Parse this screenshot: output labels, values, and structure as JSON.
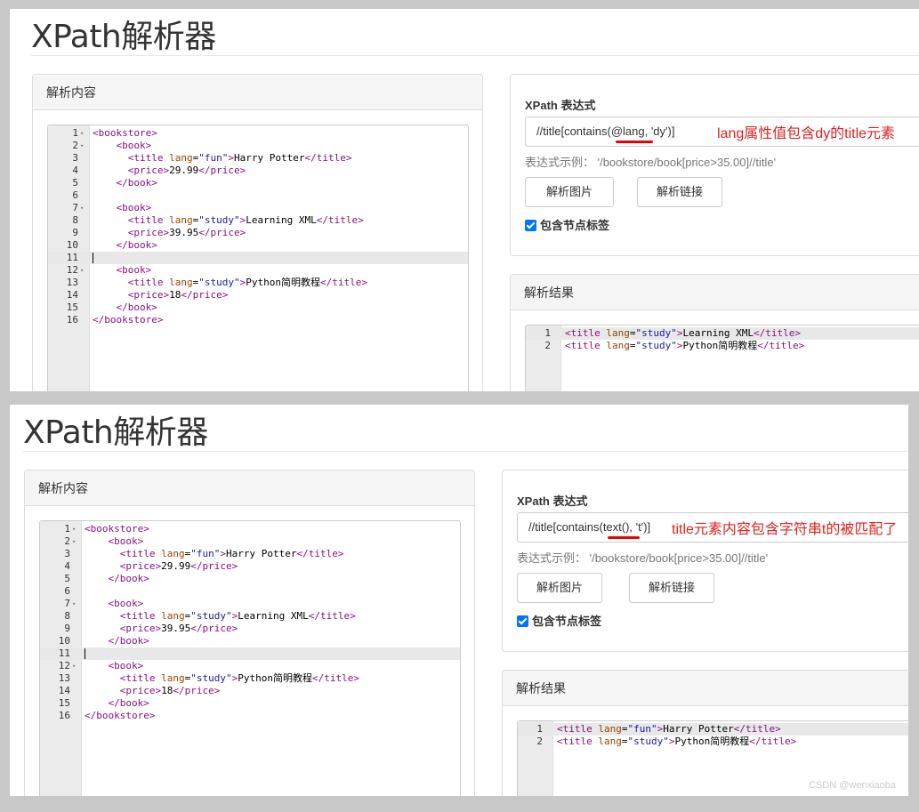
{
  "app": {
    "title": "XPath解析器"
  },
  "panels": {
    "content_heading": "解析内容",
    "xpath_heading": "XPath 表达式",
    "result_heading": "解析结果",
    "example": "表达式示例： '/bookstore/book[price>35.00]//title'",
    "btn_image": "解析图片",
    "btn_link": "解析链接",
    "include_tags": "包含节点标签"
  },
  "source_lines": [
    {
      "n": "1",
      "fold": "▾",
      "html": "<span class='tag'>&lt;bookstore&gt;</span>"
    },
    {
      "n": "2",
      "fold": "▾",
      "html": "    <span class='tag'>&lt;book&gt;</span>"
    },
    {
      "n": "3",
      "fold": "",
      "html": "      <span class='tag'>&lt;title</span> <span class='attr'>lang</span>=<span class='val'>\"fun\"</span><span class='tag'>&gt;</span>Harry Potter<span class='tag'>&lt;/title&gt;</span>"
    },
    {
      "n": "4",
      "fold": "",
      "html": "      <span class='tag'>&lt;price&gt;</span>29.99<span class='tag'>&lt;/price&gt;</span>"
    },
    {
      "n": "5",
      "fold": "",
      "html": "    <span class='tag'>&lt;/book&gt;</span>"
    },
    {
      "n": "6",
      "fold": "",
      "html": ""
    },
    {
      "n": "7",
      "fold": "▾",
      "html": "    <span class='tag'>&lt;book&gt;</span>"
    },
    {
      "n": "8",
      "fold": "",
      "html": "      <span class='tag'>&lt;title</span> <span class='attr'>lang</span>=<span class='val'>\"study\"</span><span class='tag'>&gt;</span>Learning XML<span class='tag'>&lt;/title&gt;</span>"
    },
    {
      "n": "9",
      "fold": "",
      "html": "      <span class='tag'>&lt;price&gt;</span>39.95<span class='tag'>&lt;/price&gt;</span>"
    },
    {
      "n": "10",
      "fold": "",
      "html": "    <span class='tag'>&lt;/book&gt;</span>"
    },
    {
      "n": "11",
      "fold": "",
      "html": "<span class='cursor'></span>",
      "active": true
    },
    {
      "n": "12",
      "fold": "▾",
      "html": "    <span class='tag'>&lt;book&gt;</span>"
    },
    {
      "n": "13",
      "fold": "",
      "html": "      <span class='tag'>&lt;title</span> <span class='attr'>lang</span>=<span class='val'>\"study\"</span><span class='tag'>&gt;</span>Python简明教程<span class='tag'>&lt;/title&gt;</span>"
    },
    {
      "n": "14",
      "fold": "",
      "html": "      <span class='tag'>&lt;price&gt;</span>18<span class='tag'>&lt;/price&gt;</span>"
    },
    {
      "n": "15",
      "fold": "",
      "html": "    <span class='tag'>&lt;/book&gt;</span>"
    },
    {
      "n": "16",
      "fold": "",
      "html": "<span class='tag'>&lt;/bookstore&gt;</span>"
    }
  ],
  "shots": [
    {
      "xpath": "//title[contains(@lang, 'dy')]",
      "annotation": "lang属性值包含dy的title元素",
      "result_lines": [
        {
          "n": "1",
          "html": "<span class='tag'>&lt;title</span> <span class='attr'>lang</span>=<span class='val'>\"study\"</span><span class='tag'>&gt;</span>Learning XML<span class='tag'>&lt;/title&gt;</span>"
        },
        {
          "n": "2",
          "html": "<span class='tag'>&lt;title</span> <span class='attr'>lang</span>=<span class='val'>\"study\"</span><span class='tag'>&gt;</span>Python简明教程<span class='tag'>&lt;/title&gt;</span>"
        }
      ]
    },
    {
      "xpath": "//title[contains(text(), 't')]",
      "annotation": "title元素内容包含字符串t的被匹配了",
      "result_lines": [
        {
          "n": "1",
          "html": "<span class='tag'>&lt;title</span> <span class='attr'>lang</span>=<span class='val'>\"fun\"</span><span class='tag'>&gt;</span>Harry Potter<span class='tag'>&lt;/title&gt;</span>"
        },
        {
          "n": "2",
          "html": "<span class='tag'>&lt;title</span> <span class='attr'>lang</span>=<span class='val'>\"study\"</span><span class='tag'>&gt;</span>Python简明教程<span class='tag'>&lt;/title&gt;</span>"
        }
      ]
    }
  ],
  "watermark": "CSDN @wenxiaoba"
}
